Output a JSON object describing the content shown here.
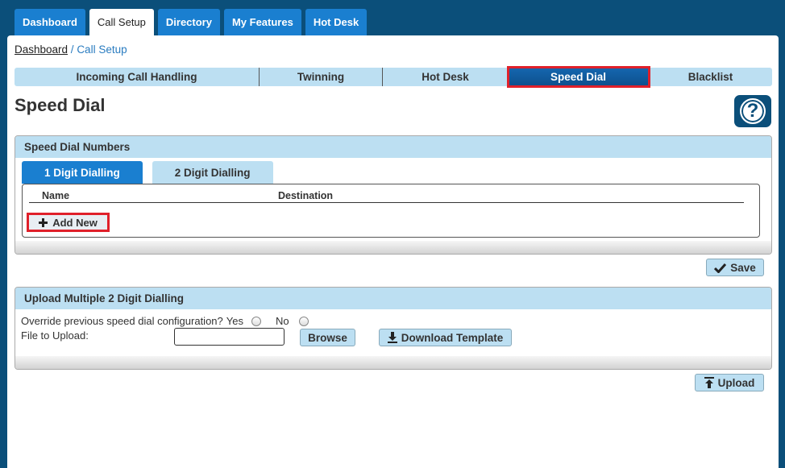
{
  "top_tabs": [
    {
      "label": "Dashboard",
      "active": false
    },
    {
      "label": "Call Setup",
      "active": true
    },
    {
      "label": "Directory",
      "active": false
    },
    {
      "label": "My Features",
      "active": false
    },
    {
      "label": "Hot Desk",
      "active": false
    }
  ],
  "breadcrumb": {
    "root": "Dashboard",
    "separator": " / ",
    "current": "Call Setup"
  },
  "subnav": [
    {
      "label": "Incoming Call Handling",
      "active": false
    },
    {
      "label": "Twinning",
      "active": false
    },
    {
      "label": "Hot Desk",
      "active": false
    },
    {
      "label": "Speed Dial",
      "active": true
    },
    {
      "label": "Blacklist",
      "active": false
    }
  ],
  "page_title": "Speed Dial",
  "help_icon": "?",
  "speed_dial_section": {
    "heading": "Speed Dial Numbers",
    "tabs": [
      {
        "label": "1 Digit Dialling",
        "active": true
      },
      {
        "label": "2 Digit Dialling",
        "active": false
      }
    ],
    "columns": {
      "name": "Name",
      "destination": "Destination"
    },
    "add_new_label": "Add New"
  },
  "save_label": "Save",
  "upload_section": {
    "heading": "Upload Multiple 2 Digit Dialling",
    "override_label": "Override previous speed dial configuration?",
    "yes_label": "Yes",
    "no_label": "No",
    "file_label": "File to Upload:",
    "browse_label": "Browse",
    "download_template_label": "Download Template"
  },
  "upload_label": "Upload",
  "colors": {
    "brand": "#0b4f7a",
    "accent": "#1a7fd0",
    "highlight": "#e0202a",
    "light": "#bcdff2"
  }
}
